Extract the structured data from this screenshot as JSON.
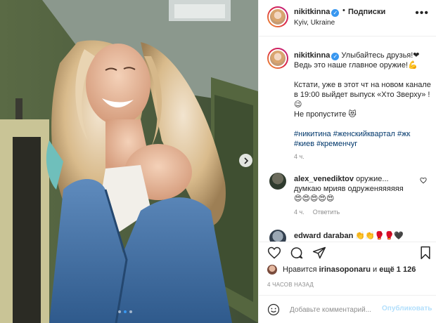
{
  "post": {
    "username": "nikitkinna",
    "follow_label": "Подписки",
    "separator": "•",
    "location": "Kyiv, Ukraine",
    "more_label": "•••",
    "verified_mark": "✓"
  },
  "caption": {
    "username": "nikitkinna",
    "line1": "Улыбайтесь друзья!❤",
    "line2": "Ведь это наше главное оружие!💪",
    "line3": "Кстати, уже в этот чт на новом канале в 19:00 выйдет выпуск «Хто Зверху» ! 😉\nНе пропустите 😻",
    "hashtags": "#никитина #женскийквартал #жк #киев #кременчуг",
    "time": "4 ч."
  },
  "comments": [
    {
      "username": "alex_venediktov",
      "text": "оружие...\nдумкаю мрияв одруженяяяяяя\n😍😍😍😍😍",
      "time": "4 ч.",
      "reply_label": "Ответить"
    },
    {
      "username": "edward daraban",
      "text": "👏👏🥊🥊🖤"
    }
  ],
  "likes": {
    "prefix": "Нравится",
    "user": "irinasoponaru",
    "conj": "и",
    "others": "ещё 1 126"
  },
  "timestamp": "4 ЧАСОВ НАЗАД",
  "comment_input": {
    "placeholder": "Добавьте комментарий...",
    "publish_label": "Опубликовать"
  },
  "carousel": {
    "active_index": 1,
    "total": 3
  },
  "colors": {
    "accent": "#3897f0",
    "link": "#00376b",
    "muted": "#8e8e8e",
    "heart": "#ed4956"
  },
  "icons": [
    "heart-icon",
    "comment-icon",
    "share-icon",
    "bookmark-icon",
    "emoji-icon",
    "chevron-right-icon",
    "verified-icon",
    "more-icon"
  ]
}
